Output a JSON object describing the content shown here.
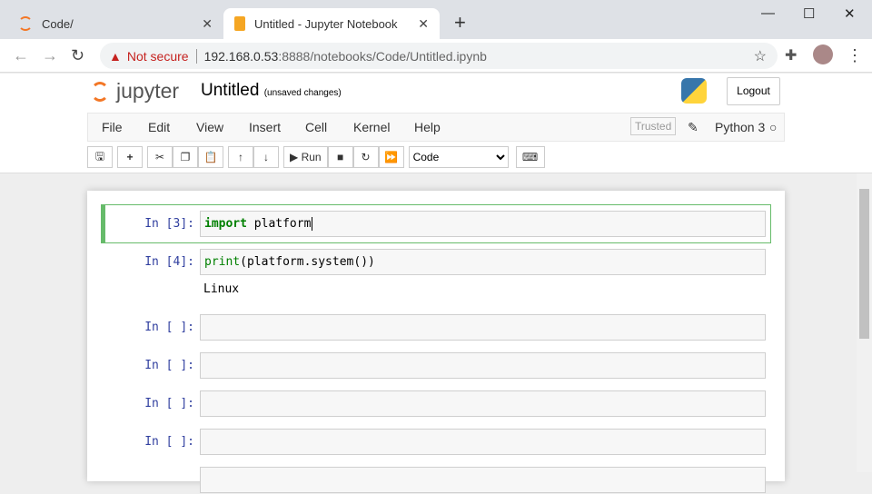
{
  "browser": {
    "tabs": [
      {
        "title": "Code/"
      },
      {
        "title": "Untitled - Jupyter Notebook"
      }
    ],
    "security": "Not secure",
    "url_host": "192.168.0.53",
    "url_rest": ":8888/notebooks/Code/Untitled.ipynb"
  },
  "header": {
    "logo": "jupyter",
    "title": "Untitled",
    "status": "(unsaved changes)",
    "logout": "Logout"
  },
  "menu": [
    "File",
    "Edit",
    "View",
    "Insert",
    "Cell",
    "Kernel",
    "Help"
  ],
  "trusted": "Trusted",
  "kernel": "Python 3",
  "toolbar": {
    "run": "Run",
    "cell_type": "Code"
  },
  "cells": [
    {
      "prompt": "In [3]:",
      "kw": "import",
      "code": " platform"
    },
    {
      "prompt": "In [4]:",
      "fn": "print",
      "code": "(platform.system())",
      "output": "Linux"
    },
    {
      "prompt": "In [ ]:"
    },
    {
      "prompt": "In [ ]:"
    },
    {
      "prompt": "In [ ]:"
    },
    {
      "prompt": "In [ ]:"
    }
  ]
}
